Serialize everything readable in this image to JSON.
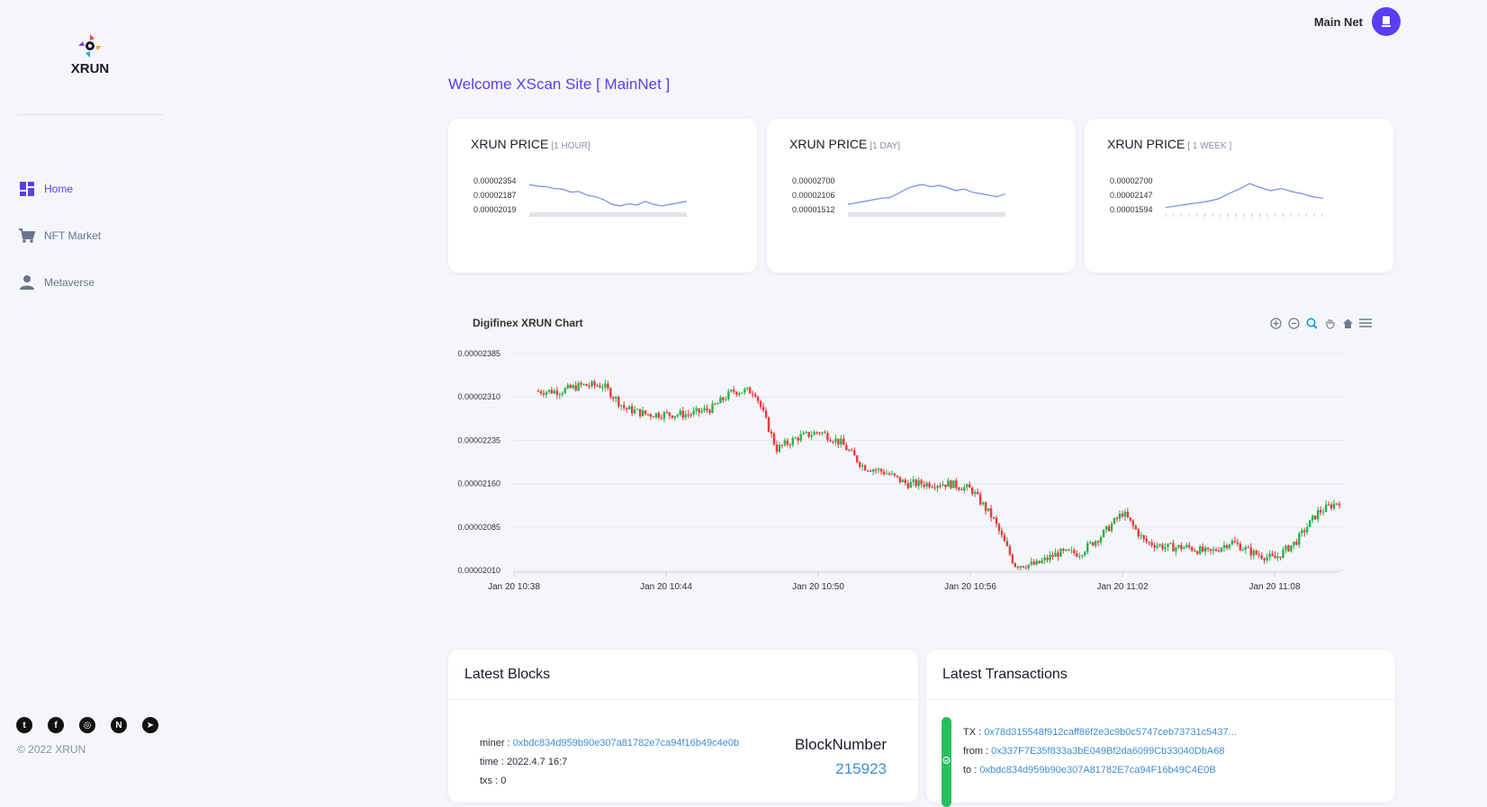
{
  "brand": {
    "name": "XRUN"
  },
  "sidebar": {
    "items": [
      {
        "label": "Home",
        "icon": "dashboard-icon",
        "active": true
      },
      {
        "label": "NFT Market",
        "icon": "cart-icon",
        "active": false
      },
      {
        "label": "Metaverse",
        "icon": "person-icon",
        "active": false
      }
    ],
    "socials": [
      "twitter-icon",
      "facebook-icon",
      "instagram-icon",
      "naver-icon",
      "telegram-icon"
    ],
    "copyright": "© 2022 XRUN"
  },
  "topbar": {
    "network_label": "Main Net"
  },
  "welcome": "Welcome XScan Site [ MainNet ]",
  "price_cards": [
    {
      "title": "XRUN PRICE",
      "range": "[1 HOUR]",
      "ticks": [
        "0.00002354",
        "0.00002187",
        "0.00002019"
      ]
    },
    {
      "title": "XRUN PRICE",
      "range": "[1 DAY]",
      "ticks": [
        "0.00002700",
        "0.00002106",
        "0.00001512"
      ]
    },
    {
      "title": "XRUN PRICE",
      "range": "[ 1 WEEK ]",
      "ticks": [
        "0.00002700",
        "0.00002147",
        "0.00001594"
      ]
    }
  ],
  "chart_data": {
    "type": "candlestick",
    "title": "Digifinex XRUN Chart",
    "y_ticks": [
      "0.00002385",
      "0.00002310",
      "0.00002235",
      "0.00002160",
      "0.00002085",
      "0.00002010"
    ],
    "ylim": [
      2.01e-05,
      2.385e-05
    ],
    "x_ticks": [
      "Jan 20 10:38",
      "Jan 20 10:44",
      "Jan 20 10:50",
      "Jan 20 10:56",
      "Jan 20 11:02",
      "Jan 20 11:08"
    ],
    "up_color": "#27b34a",
    "down_color": "#e63b3b",
    "trend_anchors": [
      2.32e-05,
      2.32e-05,
      2.33e-05,
      2.33e-05,
      2.29e-05,
      2.28e-05,
      2.28e-05,
      2.28e-05,
      2.29e-05,
      2.32e-05,
      2.32e-05,
      2.22e-05,
      2.24e-05,
      2.25e-05,
      2.23e-05,
      2.19e-05,
      2.18e-05,
      2.16e-05,
      2.16e-05,
      2.16e-05,
      2.15e-05,
      2.1e-05,
      2.02e-05,
      2.02e-05,
      2.04e-05,
      2.04e-05,
      2.07e-05,
      2.11e-05,
      2.06e-05,
      2.05e-05,
      2.05e-05,
      2.04e-05,
      2.06e-05,
      2.04e-05,
      2.03e-05,
      2.06e-05,
      2.11e-05,
      2.13e-05
    ]
  },
  "latest_blocks": {
    "title": "Latest Blocks",
    "miner_label": "miner : ",
    "miner": "0xbdc834d959b90e307a81782e7ca94f16b49c4e0b",
    "time_label": "time : ",
    "time": "2022.4.7 16:7",
    "txs_label": "txs : ",
    "txs": "0",
    "block_number_label": "BlockNumber",
    "block_number": "215923"
  },
  "latest_transactions": {
    "title": "Latest Transactions",
    "tx_label": "TX : ",
    "tx": "0x78d315548f912caff86f2e3c9b0c5747ceb73731c5437...",
    "from_label": "from : ",
    "from": "0x337F7E35f833a3bE049Bf2da6099Cb33040DbA68",
    "to_label": "to : ",
    "to": "0xbdc834d959b90e307A81782E7ca94F16b49C4E0B"
  }
}
